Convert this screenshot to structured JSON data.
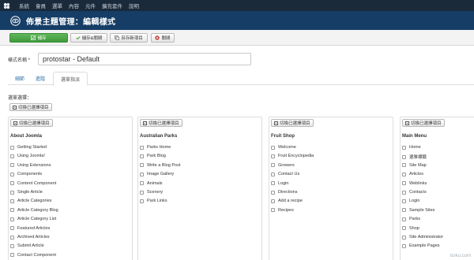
{
  "topbar": {
    "logo_icon": "joomla-logo-icon",
    "items": [
      {
        "label": "系統"
      },
      {
        "label": "會員"
      },
      {
        "label": "選單"
      },
      {
        "label": "內容"
      },
      {
        "label": "元件"
      },
      {
        "label": "擴充套件"
      },
      {
        "label": "說明"
      }
    ]
  },
  "header": {
    "icon": "eye-icon",
    "title": "佈景主題管理：編輯樣式"
  },
  "toolbar": {
    "save_label": "儲存",
    "save_close_label": "儲存&關閉",
    "save_copy_label": "另存新項目",
    "close_label": "關閉",
    "accent_color": "#46a546",
    "close_icon_color": "#bd362f"
  },
  "form": {
    "name_label": "樣式名稱 *",
    "name_value": "protostar - Default"
  },
  "tabs": [
    {
      "label": "細節"
    },
    {
      "label": "進階"
    },
    {
      "label": "選單指派"
    }
  ],
  "assignment": {
    "select_label": "選單選擇：",
    "toggle_label": "切換已選擇項目"
  },
  "menus": [
    {
      "title": "About Joomla",
      "toggle_label": "切換已選擇項目",
      "items": [
        "Getting Started",
        "Using Joomla!",
        "Using Extensions",
        "Components",
        "Content Component",
        "Single Article",
        "Article Categories",
        "Article Category Blog",
        "Article Category List",
        "Featured Articles",
        "Archived Articles",
        "Submit Article",
        "Contact Component"
      ]
    },
    {
      "title": "Australian Parks",
      "toggle_label": "切換已選擇項目",
      "items": [
        "Parks Home",
        "Park Blog",
        "Write a Blog Post",
        "Image Gallery",
        "Animals",
        "Scenery",
        "Park Links"
      ]
    },
    {
      "title": "Fruit Shop",
      "toggle_label": "切換已選擇項目",
      "items": [
        "Welcome",
        "Fruit Encyclopedia",
        "Growers",
        "Contact Us",
        "Login",
        "Directions",
        "Add a recipe",
        "Recipes"
      ]
    },
    {
      "title": "Main Menu",
      "toggle_label": "切換已選擇項目",
      "items": [
        "Home",
        "選單標籤",
        "Site Map",
        "Articles",
        "Weblinks",
        "Contacts",
        "Login",
        "Sample Sites",
        "Parks",
        "Shop",
        "Site Administrator",
        "Example Pages"
      ]
    }
  ],
  "watermark": "boku.com"
}
